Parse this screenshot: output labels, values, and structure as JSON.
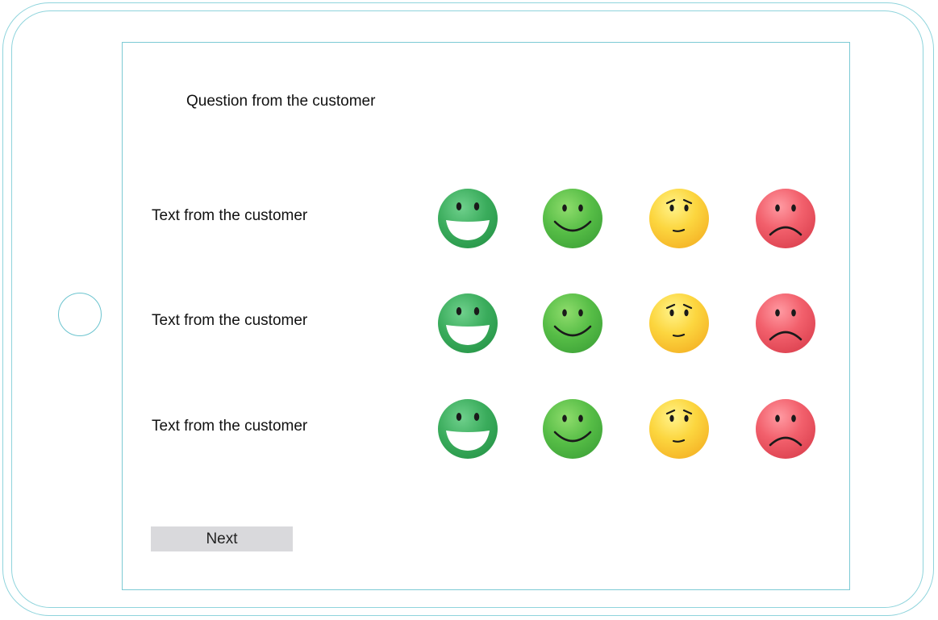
{
  "question": {
    "title": "Question from the customer"
  },
  "rows": [
    {
      "text": "Text from the customer"
    },
    {
      "text": "Text from the customer"
    },
    {
      "text": "Text from the customer"
    }
  ],
  "rating_options": [
    {
      "icon": "big-smile-face-icon",
      "color": "#3fae5f"
    },
    {
      "icon": "smile-face-icon",
      "color": "#5cc04a"
    },
    {
      "icon": "worried-face-icon",
      "color": "#fbd23a"
    },
    {
      "icon": "sad-face-icon",
      "color": "#ef5b67"
    }
  ],
  "next_button": {
    "label": "Next"
  }
}
